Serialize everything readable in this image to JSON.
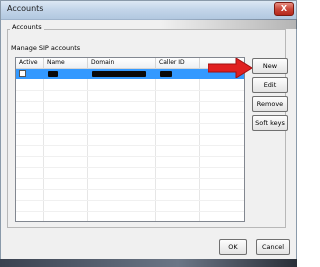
{
  "window": {
    "title": "Accounts",
    "close_glyph": "X"
  },
  "group": {
    "label": "Accounts",
    "description": "Manage SIP accounts"
  },
  "list": {
    "columns": [
      "Active",
      "Name",
      "Domain",
      "Caller ID"
    ],
    "rows": [
      {
        "active": false,
        "name": "",
        "domain": "",
        "caller_id": ""
      }
    ],
    "selected_row_color": "#3399ff"
  },
  "side_buttons": {
    "new": "New",
    "edit": "Edit",
    "remove": "Remove",
    "soft_keys": "Soft keys"
  },
  "dialog_buttons": {
    "ok": "OK",
    "cancel": "Cancel"
  },
  "annotation": {
    "arrow_color": "#e02020",
    "arrow_icon": "red-arrow-icon"
  }
}
